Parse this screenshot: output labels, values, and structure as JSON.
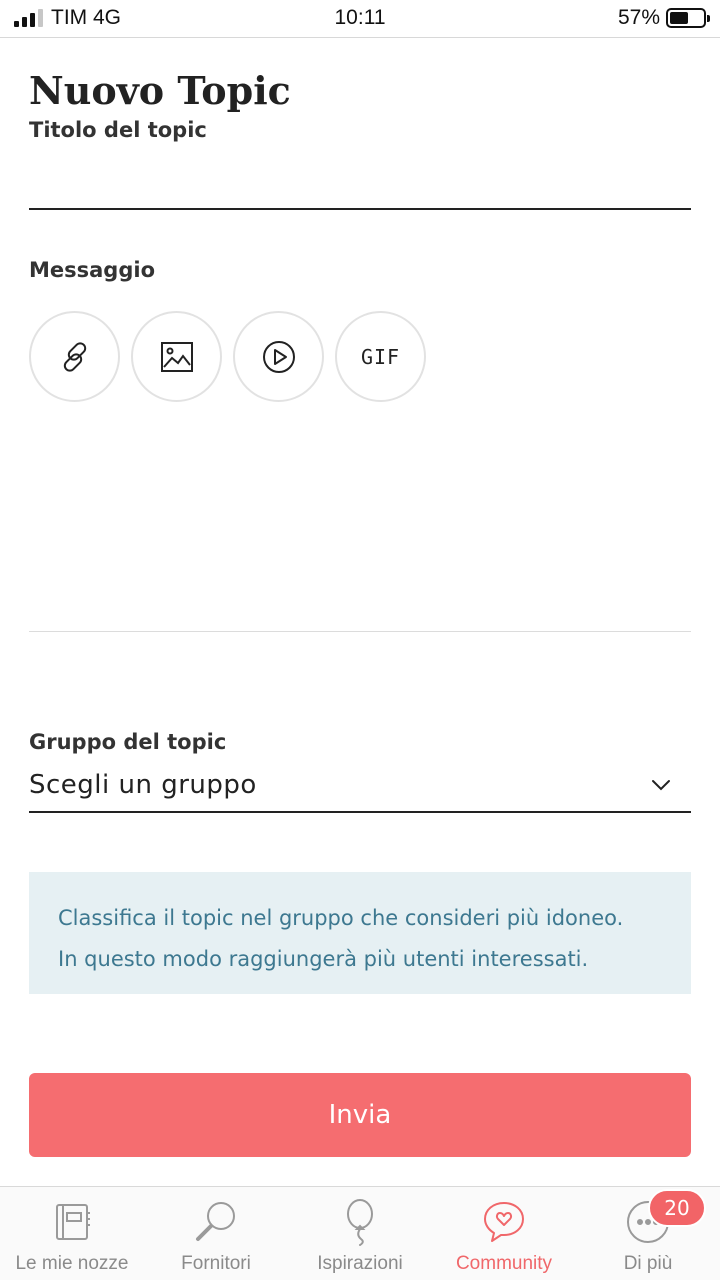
{
  "status_bar": {
    "carrier": "TIM 4G",
    "time": "10:11",
    "battery": "57%",
    "battery_level": 0.57
  },
  "header": {
    "title": "Nuovo Topic"
  },
  "form": {
    "title_label": "Titolo del topic",
    "title_value": "",
    "message_label": "Messaggio",
    "toolbar": [
      {
        "icon": "link-icon"
      },
      {
        "icon": "image-icon"
      },
      {
        "icon": "video-icon"
      },
      {
        "icon": "gif-icon",
        "label": "GIF"
      }
    ],
    "message_value": "",
    "group_label": "Gruppo del topic",
    "group_select_value": "Scegli un gruppo",
    "info_line_1": "Classifica il topic nel gruppo che consideri più idoneo.",
    "info_line_2": "In questo modo raggiungerà più utenti interessati.",
    "submit_label": "Invia"
  },
  "bottom_nav": {
    "items": [
      {
        "label": "Le mie nozze",
        "icon": "notebook-icon",
        "active": false
      },
      {
        "label": "Fornitori",
        "icon": "magnifier-icon",
        "active": false
      },
      {
        "label": "Ispirazioni",
        "icon": "balloon-icon",
        "active": false
      },
      {
        "label": "Community",
        "icon": "chat-heart-icon",
        "active": true
      },
      {
        "label": "Di più",
        "icon": "more-icon",
        "active": false,
        "badge": "20"
      }
    ]
  },
  "colors": {
    "accent": "#f56d70",
    "info_bg": "#e6f0f3",
    "info_text": "#3d7890",
    "nav_active": "#f0676a"
  }
}
